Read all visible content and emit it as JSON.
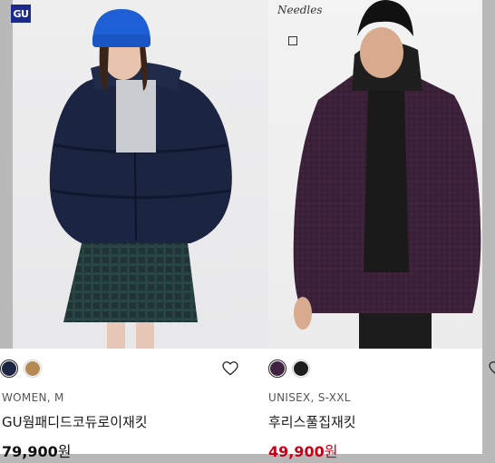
{
  "products": [
    {
      "brand_badge": "GU",
      "swatches": [
        {
          "name": "navy",
          "color": "#1c2541",
          "selected": true
        },
        {
          "name": "camel",
          "color": "#b58a52",
          "selected": false
        }
      ],
      "meta": "WOMEN, M",
      "name": "GU웜패디드코듀로이재킷",
      "price": "79,900",
      "currency": "원"
    },
    {
      "brand_badge": "",
      "swatches": [
        {
          "name": "purple",
          "color": "#3f2340",
          "selected": true
        },
        {
          "name": "black",
          "color": "#1d1d1d",
          "selected": false
        }
      ],
      "meta": "UNISEX, S-XXL",
      "name": "후리스풀집재킷",
      "price": "49,900",
      "currency": "원",
      "price_color": "#c40018"
    }
  ]
}
